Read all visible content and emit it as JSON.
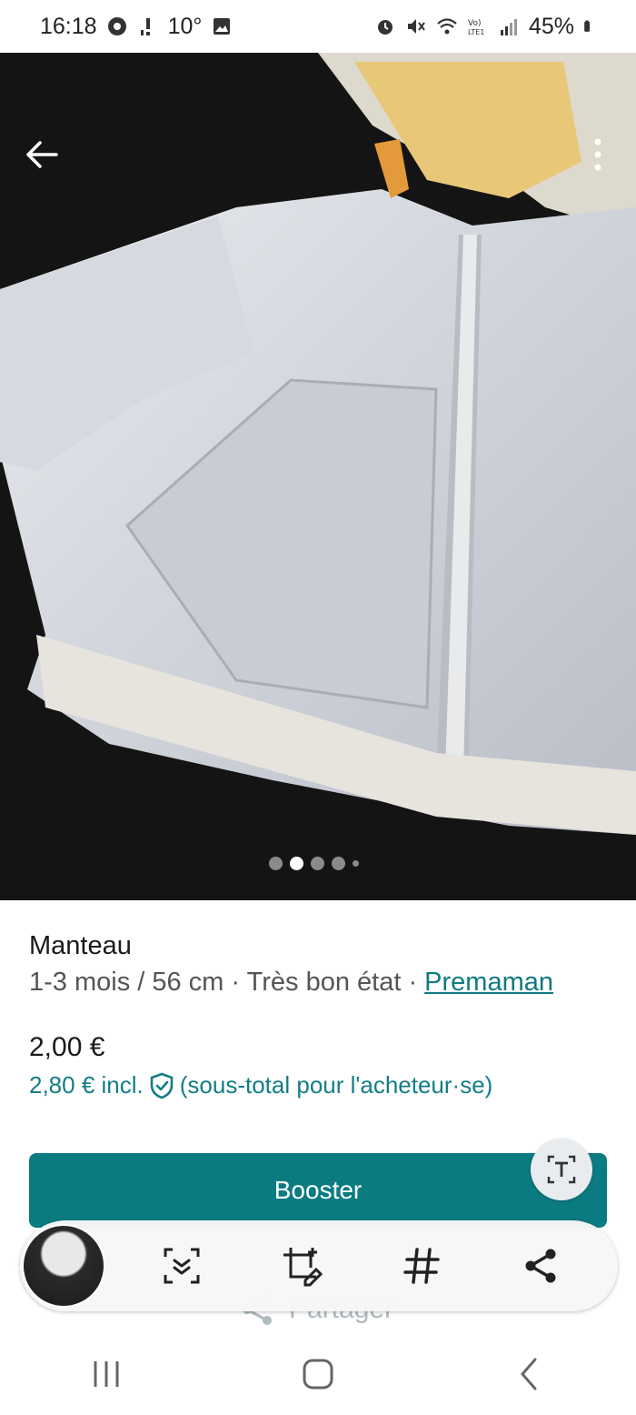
{
  "status_bar": {
    "time": "16:18",
    "temp": "10°",
    "battery": "45%",
    "left_icons": [
      "chrome-icon",
      "alert-icon",
      "image-icon"
    ],
    "right_icons": [
      "alarm-icon",
      "mute-icon",
      "wifi-icon",
      "volte-icon",
      "signal-icon",
      "battery-icon"
    ]
  },
  "photo": {
    "pager_count": 5,
    "pager_active": 2
  },
  "item": {
    "title": "Manteau",
    "size": "1-3 mois / 56 cm",
    "separator": " · ",
    "condition": "Très bon état",
    "brand": "Premaman",
    "price": "2,00 €",
    "buyer_price": "2,80 € incl.",
    "buyer_note": "(sous-total pour l'acheteur·se)"
  },
  "actions": {
    "booster_label": "Booster",
    "share_label": "Partager"
  },
  "capture_toolbar": {
    "buttons": [
      "scroll-capture-icon",
      "edit-crop-icon",
      "hashtag-icon",
      "share-icon"
    ]
  },
  "colors": {
    "accent": "#0b7b82",
    "link": "#0f7a82"
  }
}
